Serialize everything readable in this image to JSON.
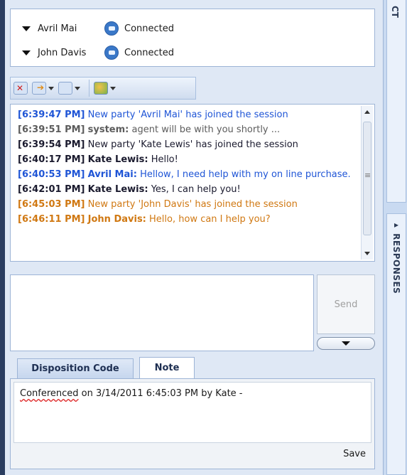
{
  "participants": [
    {
      "name": "Avril Mai",
      "status": "Connected"
    },
    {
      "name": "John Davis",
      "status": "Connected"
    }
  ],
  "toolbar": {
    "icons": [
      "end-session-icon",
      "transfer-icon",
      "conference-icon",
      "contacts-icon"
    ]
  },
  "chat": [
    {
      "time": "[6:39:47 PM]",
      "sender": "",
      "text": "New party 'Avril Mai' has joined the session",
      "color": "blue"
    },
    {
      "time": "[6:39:51 PM]",
      "sender": "system:",
      "text": "agent will be with you shortly ...",
      "color": "gray"
    },
    {
      "time": "[6:39:54 PM]",
      "sender": "",
      "text": "New party 'Kate Lewis' has joined the session",
      "color": "dark"
    },
    {
      "time": "[6:40:17 PM]",
      "sender": "Kate Lewis:",
      "text": "Hello!",
      "color": "dark"
    },
    {
      "time": "[6:40:53 PM]",
      "sender": "Avril Mai:",
      "text": "Hellow, I need help with my on line purchase.",
      "color": "blue"
    },
    {
      "time": "[6:42:01 PM]",
      "sender": "Kate Lewis:",
      "text": "Yes, I can help you!",
      "color": "dark"
    },
    {
      "time": "[6:45:03 PM]",
      "sender": "",
      "text": "New party 'John Davis' has joined the session",
      "color": "orange"
    },
    {
      "time": "[6:46:11 PM]",
      "sender": "John Davis:",
      "text": "Hello, how can I help you?",
      "color": "orange"
    }
  ],
  "compose": {
    "value": "",
    "send_label": "Send"
  },
  "tabs": [
    {
      "label": "Disposition Code",
      "active": false
    },
    {
      "label": "Note",
      "active": true
    }
  ],
  "note": {
    "prefix": "Conferenced",
    "rest": " on 3/14/2011 6:45:03 PM by Kate -",
    "save_label": "Save"
  },
  "side_tabs": {
    "top": "CT",
    "responses": "▸ RESPONSES"
  },
  "colors": {
    "blue": "#1f55d6",
    "gray": "#5c5c5c",
    "dark": "#1a1a2e",
    "orange": "#d07812",
    "connected_icon": "#3a78c8"
  }
}
